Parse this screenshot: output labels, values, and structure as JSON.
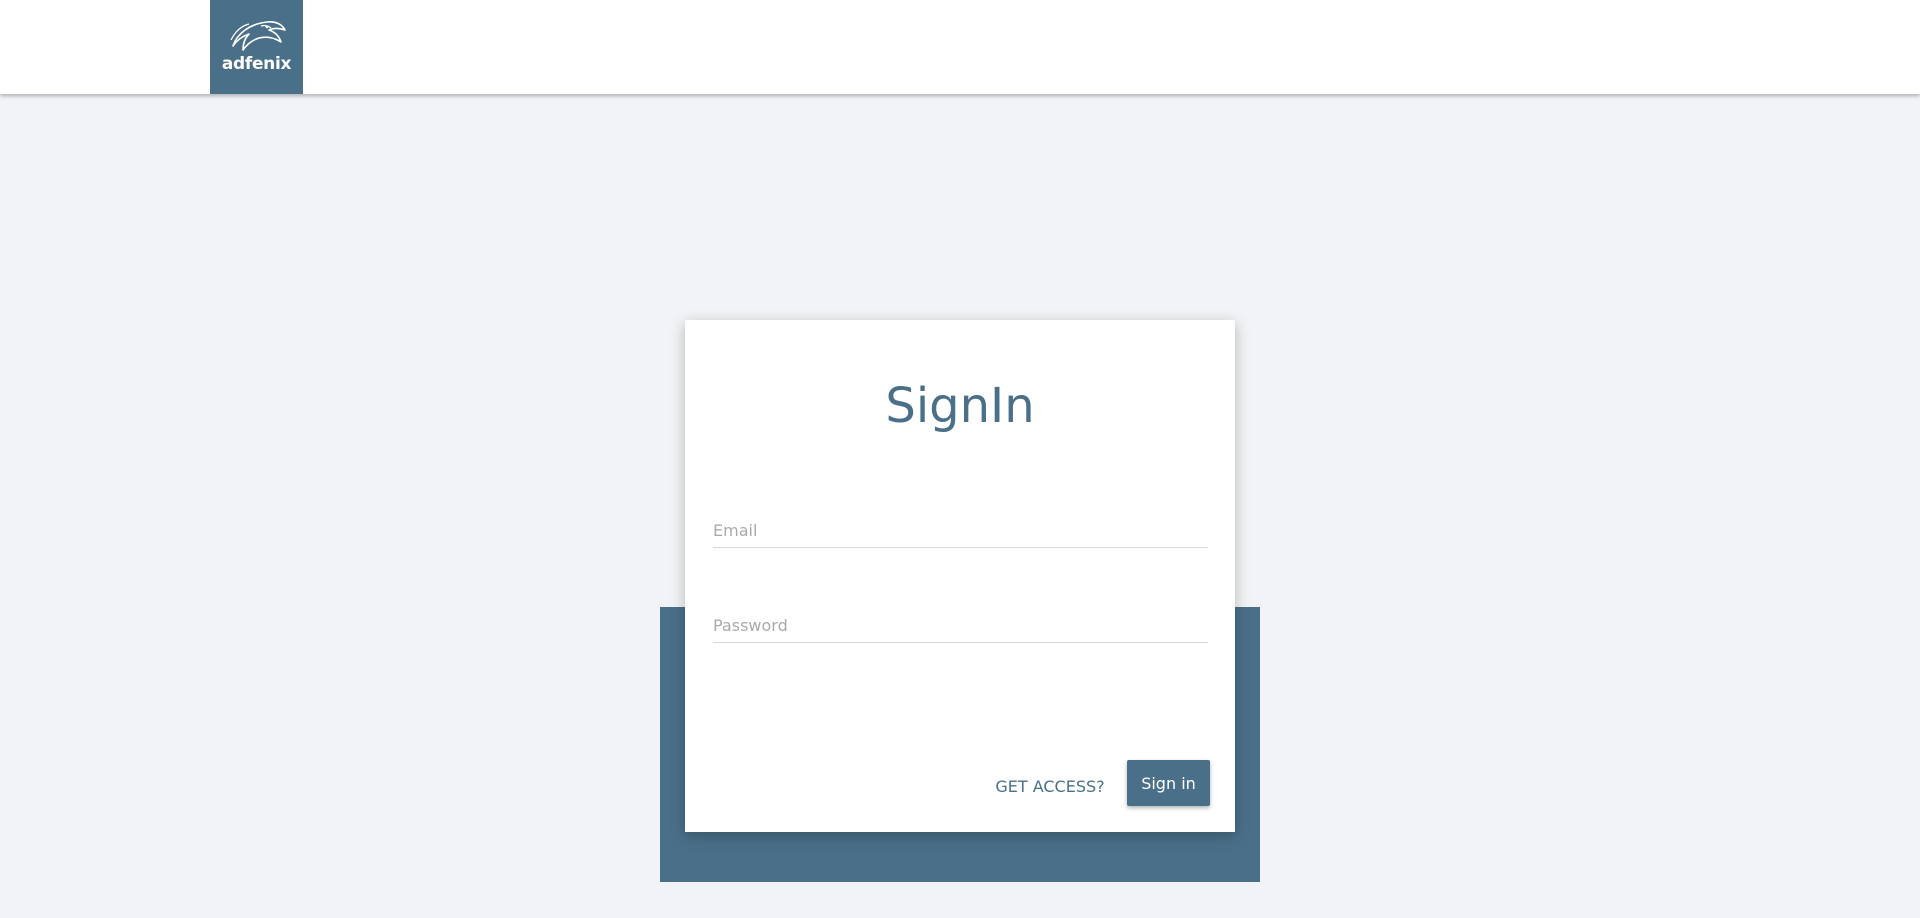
{
  "header": {
    "logo_text": "adfenix",
    "logo_icon": "eagle-head-icon"
  },
  "signin": {
    "title": "SignIn",
    "email_placeholder": "Email",
    "email_value": "",
    "password_placeholder": "Password",
    "password_value": "",
    "get_access_label": "GET ACCESS?",
    "signin_label": "Sign in"
  },
  "colors": {
    "brand": "#4a7089",
    "background": "#f1f3f6",
    "card": "#ffffff"
  }
}
